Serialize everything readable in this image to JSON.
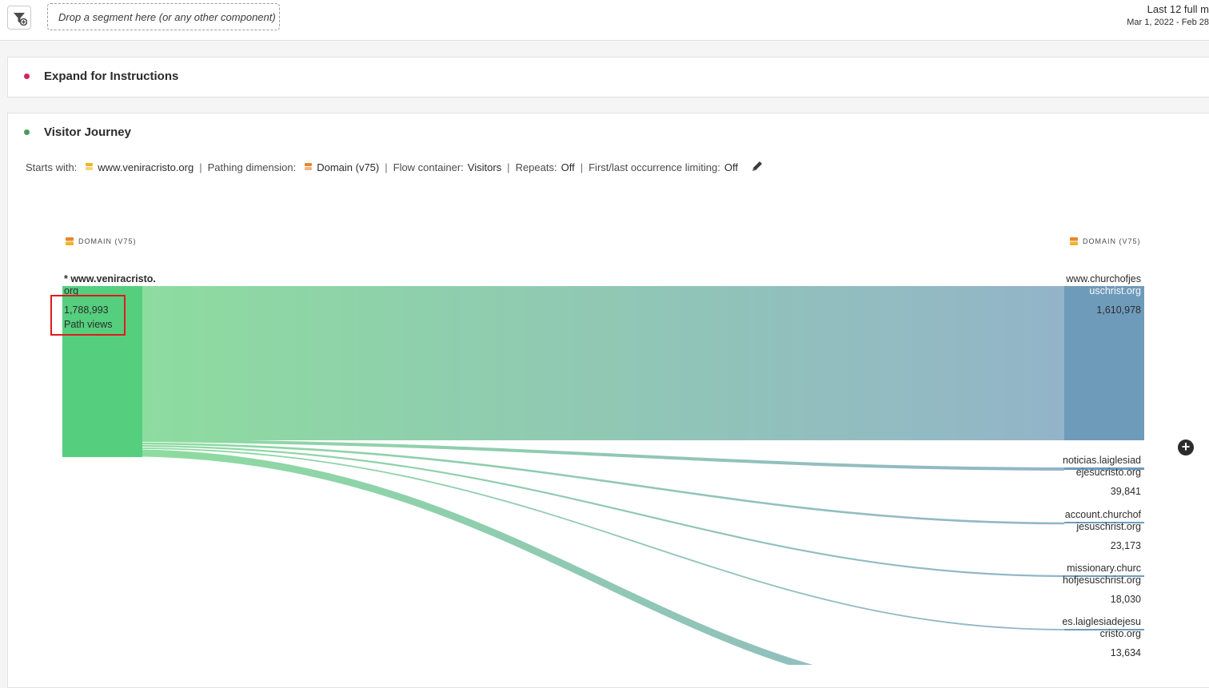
{
  "toolbar": {
    "drop_zone_placeholder": "Drop a segment here (or any other component)",
    "date_range_label": "Last 12 full m",
    "date_range_dates": "Mar 1, 2022 - Feb 28"
  },
  "panels": {
    "instructions": {
      "title": "Expand for Instructions",
      "status_color": "#d1245c"
    },
    "journey": {
      "title": "Visitor Journey",
      "status_color": "#4a9a5f"
    }
  },
  "settings": {
    "starts_with_label": "Starts with:",
    "starts_with_value": "www.veniracristo.org",
    "pathing_label": "Pathing dimension:",
    "pathing_value": "Domain (v75)",
    "container_label": "Flow container:",
    "container_value": "Visitors",
    "repeats_label": "Repeats:",
    "repeats_value": "Off",
    "limiting_label": "First/last occurrence limiting:",
    "limiting_value": "Off",
    "separator": "|"
  },
  "flow": {
    "left_header": "DOMAIN (V75)",
    "right_header": "DOMAIN (V75)",
    "start_node": {
      "name_line1": "* www.veniracristo.",
      "name_line2": "org",
      "value": "1,788,993",
      "metric": "Path views"
    },
    "destinations": [
      {
        "name_line1": "www.churchofjes",
        "name_line2": "uschrist.org",
        "value": "1,610,978"
      },
      {
        "name_line1": "noticias.laiglesiad",
        "name_line2": "ejesucristo.org",
        "value": "39,841"
      },
      {
        "name_line1": "account.churchof",
        "name_line2": "jesuschrist.org",
        "value": "23,173"
      },
      {
        "name_line1": "missionary.churc",
        "name_line2": "hofjesuschrist.org",
        "value": "18,030"
      },
      {
        "name_line1": "es.laiglesiadejesu",
        "name_line2": "cristo.org",
        "value": "13,634"
      }
    ],
    "colors": {
      "start_node": "#55cf7e",
      "main_dest_node": "#6f9bbb",
      "minor_dest_line": "#6f9bbb",
      "flow_start": "#8ddc9f",
      "flow_end": "#93b4c9"
    }
  }
}
